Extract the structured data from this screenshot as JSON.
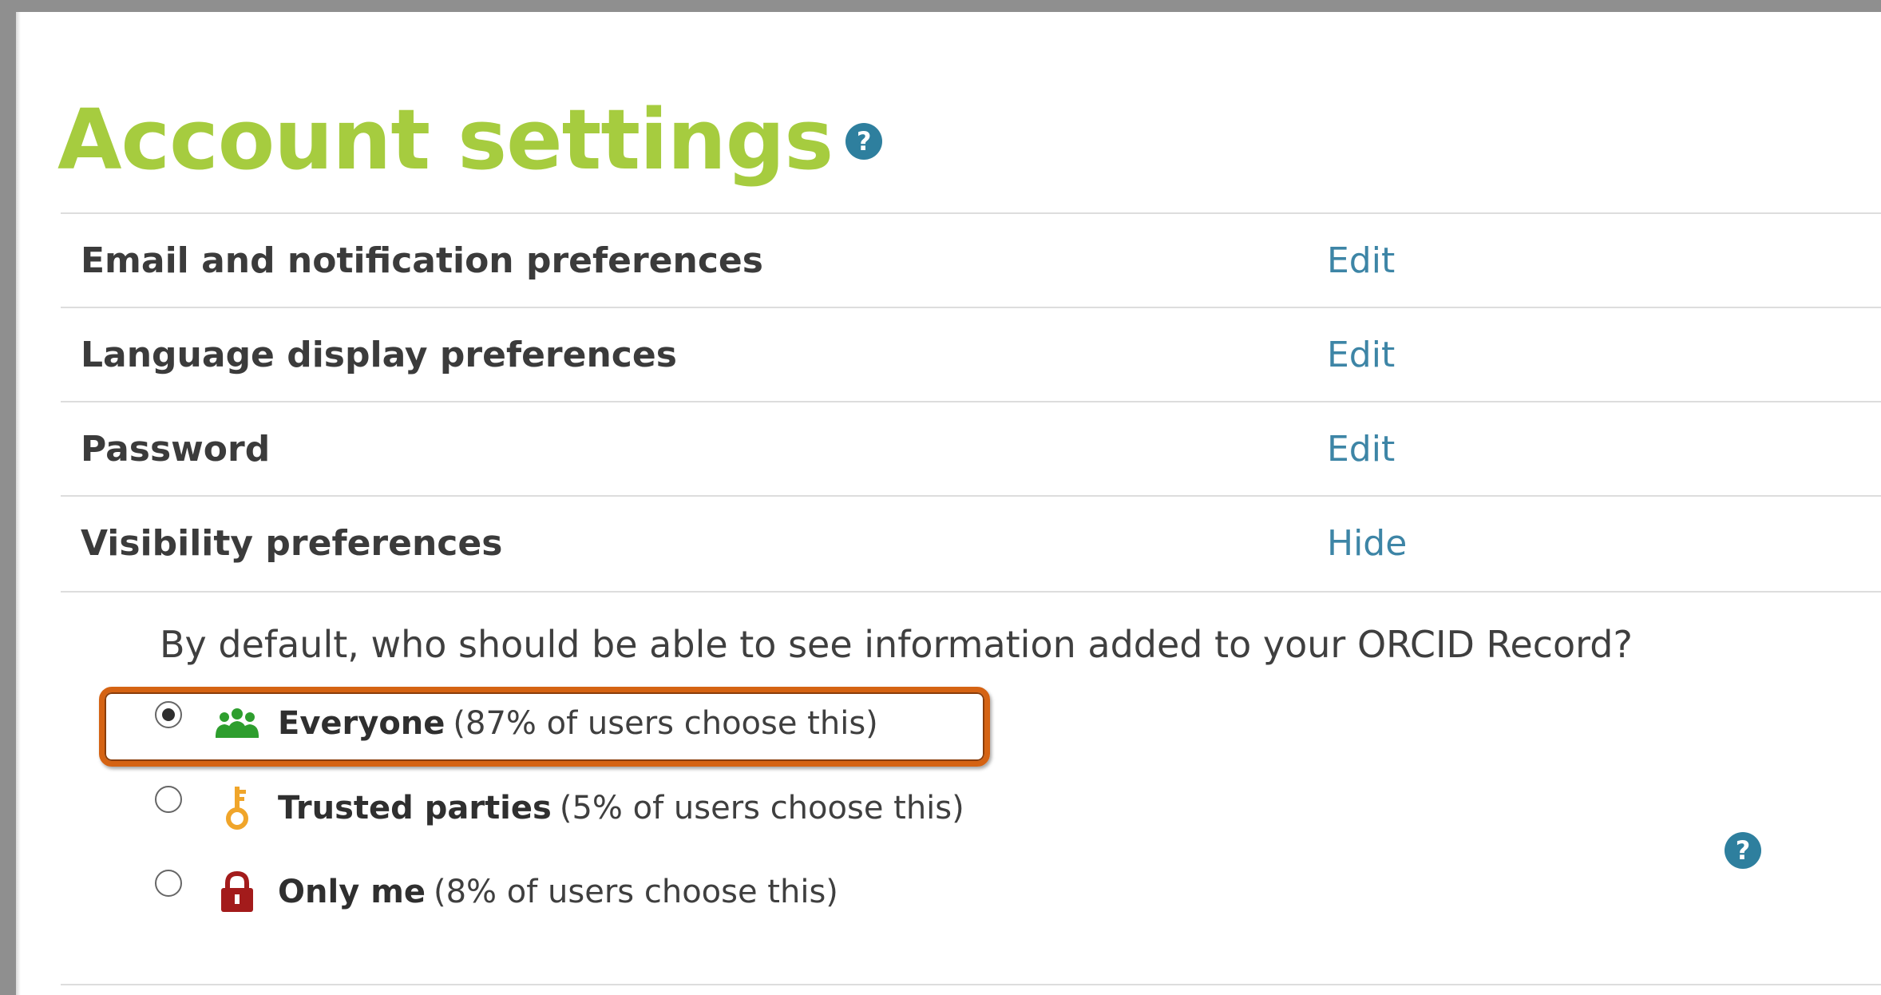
{
  "page": {
    "title": "Account settings",
    "title_help_icon": "help-icon",
    "title_color": "#a6cc3f",
    "link_color": "#3d85a6"
  },
  "settings": [
    {
      "label": "Email and notification preferences",
      "action": "Edit"
    },
    {
      "label": "Language display preferences",
      "action": "Edit"
    },
    {
      "label": "Password",
      "action": "Edit"
    },
    {
      "label": "Visibility preferences",
      "action": "Hide"
    }
  ],
  "visibility": {
    "question": "By default, who should be able to see information added to your ORCID Record?",
    "selected": "Everyone",
    "highlight_color": "#d56313",
    "options": [
      {
        "name": "Everyone",
        "stat": "(87% of users choose this)",
        "icon": "group-icon",
        "icon_color": "#2e9e2e",
        "checked": true
      },
      {
        "name": "Trusted parties",
        "stat": "(5% of users choose this)",
        "icon": "key-icon",
        "icon_color": "#f0a52a",
        "checked": false
      },
      {
        "name": "Only me",
        "stat": "(8% of users choose this)",
        "icon": "lock-icon",
        "icon_color": "#a31b1b",
        "checked": false
      }
    ],
    "help_icon": "help-icon"
  }
}
